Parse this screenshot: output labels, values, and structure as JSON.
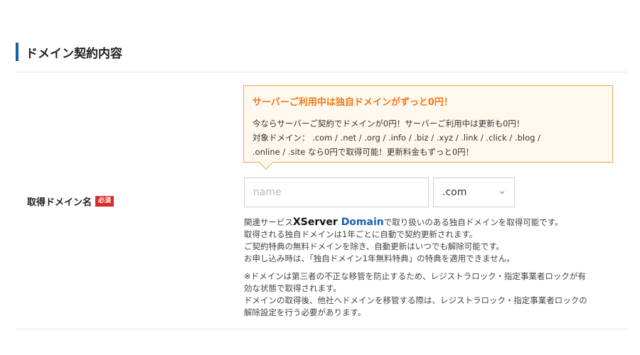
{
  "section": {
    "title": "ドメイン契約内容"
  },
  "row": {
    "label": "取得ドメイン名",
    "required_badge": "必須"
  },
  "promo": {
    "title": "サーバーご利用中は独自ドメインがずっと0円！",
    "lines": [
      "今ならサーバーご契約でドメインが0円！サーバーご利用中は更新も0円！",
      "対象ドメイン：  .com / .net / .org / .info / .biz / .xyz / .link / .click / .blog /",
      ".online / .site なら0円で取得可能！更新料金もずっと0円！"
    ],
    "colors": {
      "border": "#f0a25a",
      "title": "#f07a1a",
      "background": "#fff8ee"
    }
  },
  "domain_input": {
    "value": "",
    "placeholder": "name"
  },
  "tld_select": {
    "selected": ".com",
    "icon": "chevron-down-icon"
  },
  "notes": {
    "intro_prefix": "関連サービス",
    "brand_xserver": "XServer",
    "brand_domain": "Domain",
    "intro_suffix": "で取り扱いのある独自ドメインを取得可能です。",
    "lines": [
      "取得される独自ドメインは1年ごとに自動で契約更新されます。",
      "ご契約特典の無料ドメインを除き、自動更新はいつでも解除可能です。",
      "お申し込み時は、「独自ドメイン1年無料特典」の特典を適用できません。"
    ],
    "warning_lines": [
      "※ドメインは第三者の不正な移管を防止するため、レジストラロック・指定事業者ロックが有",
      "効な状態で取得されます。",
      "ドメインの取得後、他社へドメインを移管する際は、レジストラロック・指定事業者ロックの",
      "解除設定を行う必要があります。"
    ]
  },
  "colors": {
    "accent": "#1a5fa8",
    "required": "#d92b2b"
  }
}
